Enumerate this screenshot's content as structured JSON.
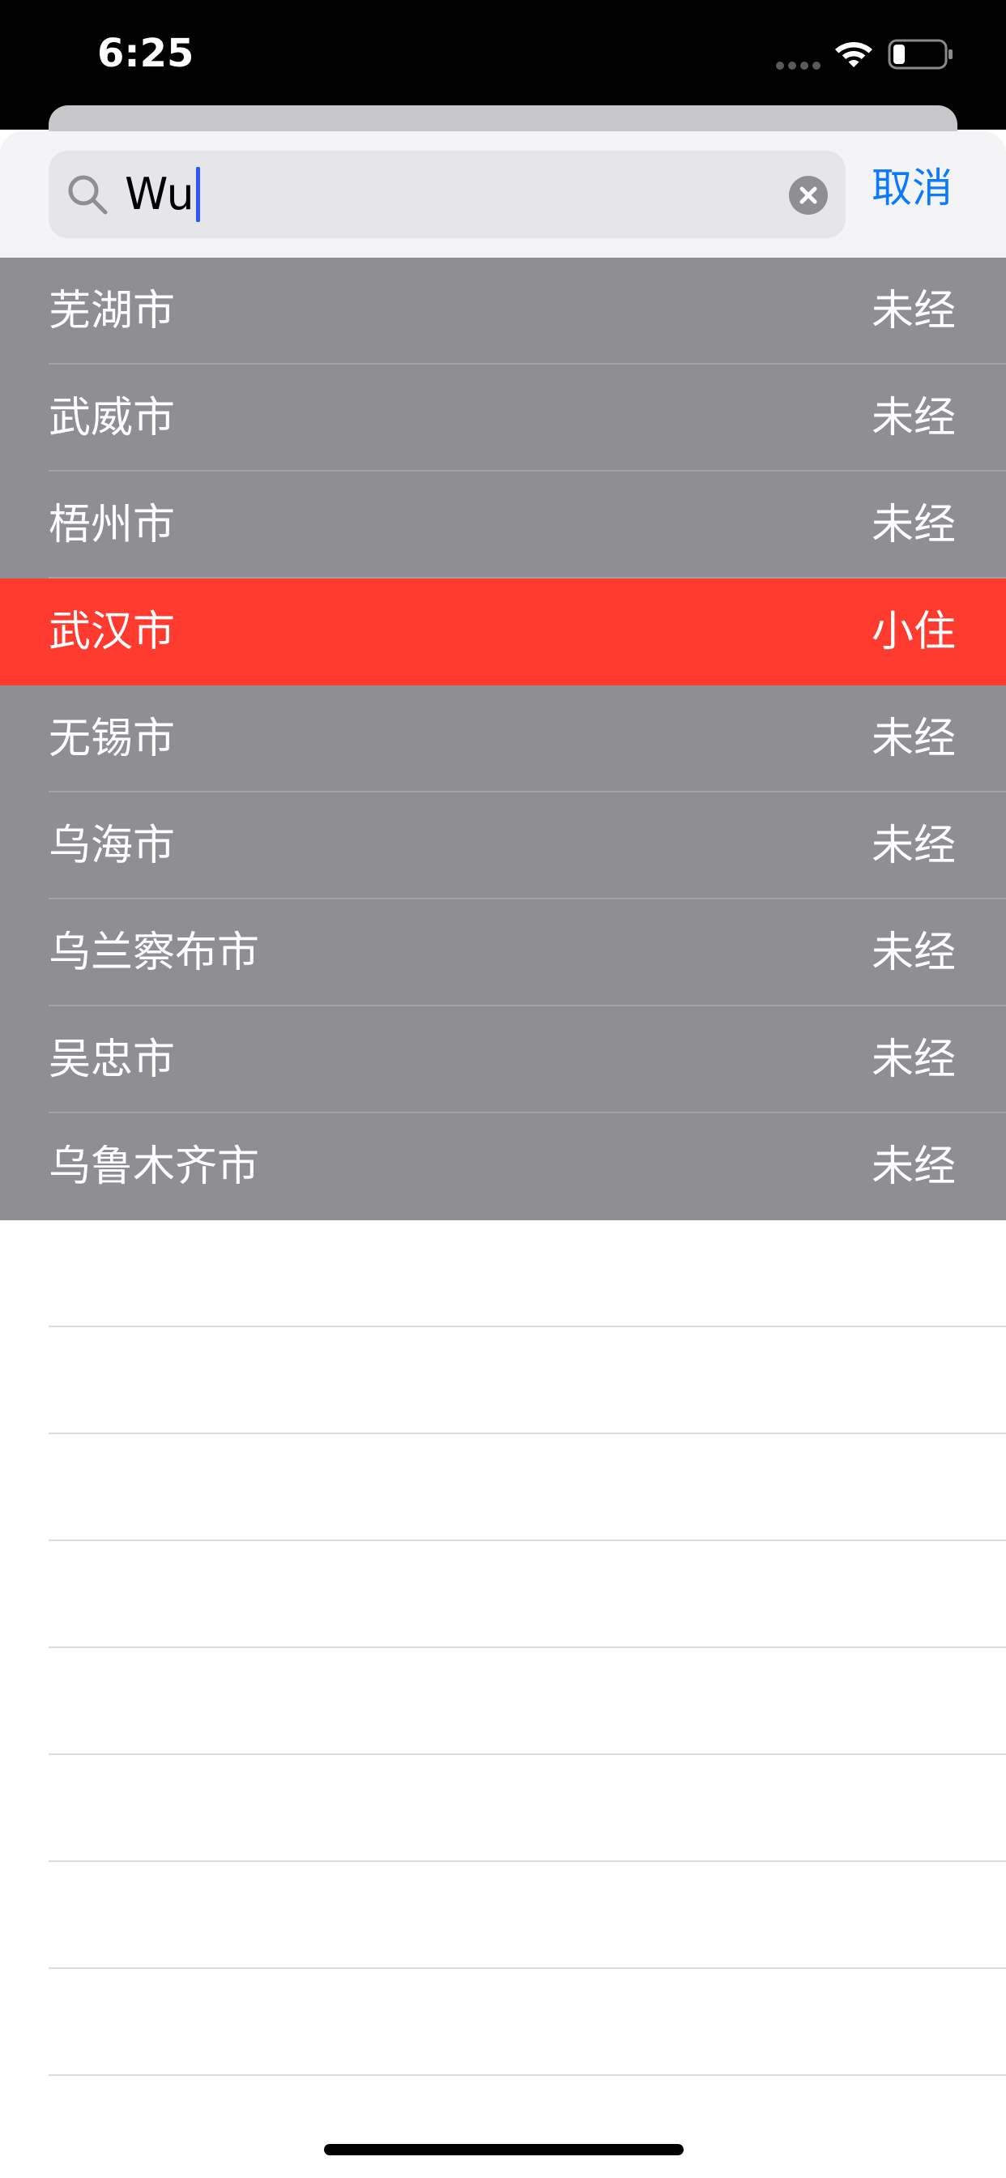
{
  "status_bar": {
    "time": "6:25"
  },
  "search": {
    "query": "Wu",
    "cancel_label": "取消"
  },
  "results": [
    {
      "city": "芜湖市",
      "status": "未经"
    },
    {
      "city": "武威市",
      "status": "未经"
    },
    {
      "city": "梧州市",
      "status": "未经"
    },
    {
      "city": "武汉市",
      "status": "小住",
      "highlighted": true
    },
    {
      "city": "无锡市",
      "status": "未经"
    },
    {
      "city": "乌海市",
      "status": "未经"
    },
    {
      "city": "乌兰察布市",
      "status": "未经"
    },
    {
      "city": "吴忠市",
      "status": "未经"
    },
    {
      "city": "乌鲁木齐市",
      "status": "未经"
    }
  ],
  "colors": {
    "row_background": "#8e8e93",
    "highlight": "#ff3b30",
    "accent": "#0a7aff",
    "caret": "#2f56ff"
  },
  "icons": [
    "wifi-icon",
    "battery-icon",
    "search-icon",
    "clear-icon"
  ]
}
